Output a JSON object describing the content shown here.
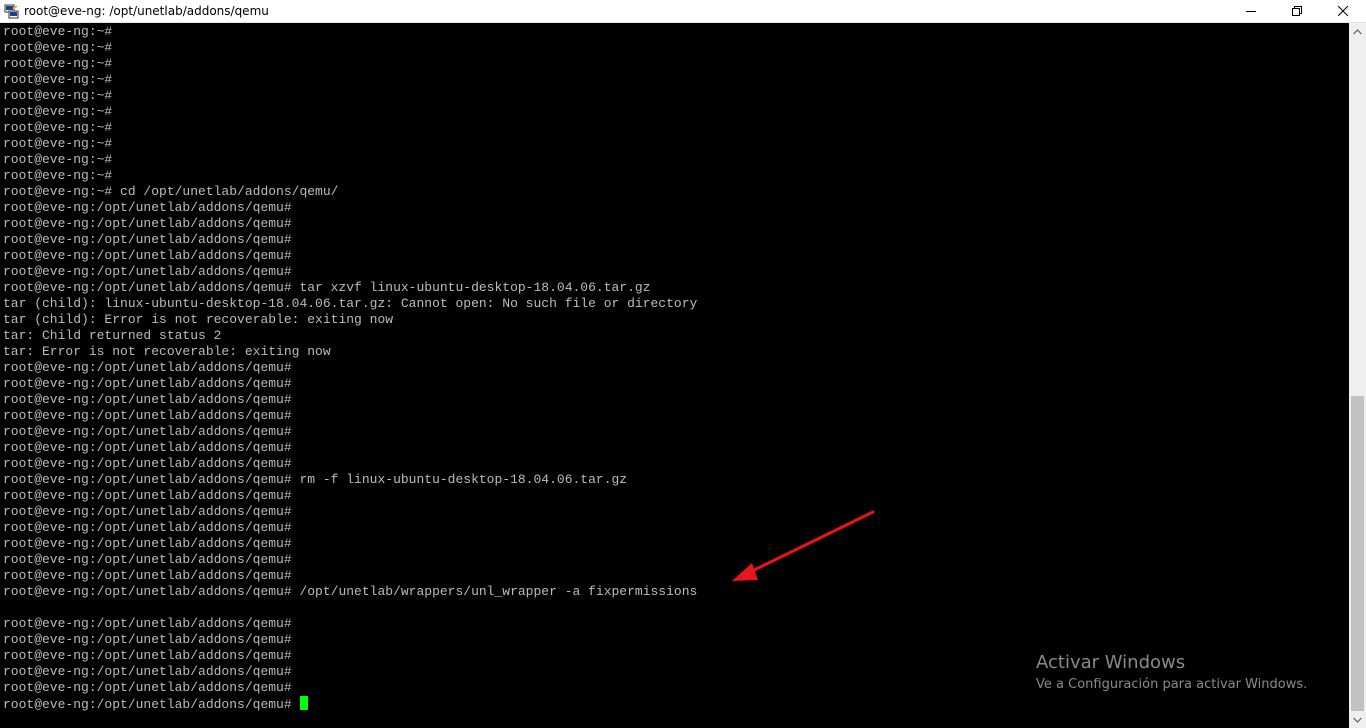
{
  "window": {
    "title": "root@eve-ng: /opt/unetlab/addons/qemu",
    "icon": "putty-icon",
    "controls": [
      "minimize-icon",
      "maximize-icon",
      "close-icon"
    ]
  },
  "terminal": {
    "text_color": "#bbbbbb",
    "cursor_color": "#00ff00",
    "lines": [
      "root@eve-ng:~#",
      "root@eve-ng:~#",
      "root@eve-ng:~#",
      "root@eve-ng:~#",
      "root@eve-ng:~#",
      "root@eve-ng:~#",
      "root@eve-ng:~#",
      "root@eve-ng:~#",
      "root@eve-ng:~#",
      "root@eve-ng:~#",
      "root@eve-ng:~# cd /opt/unetlab/addons/qemu/",
      "root@eve-ng:/opt/unetlab/addons/qemu#",
      "root@eve-ng:/opt/unetlab/addons/qemu#",
      "root@eve-ng:/opt/unetlab/addons/qemu#",
      "root@eve-ng:/opt/unetlab/addons/qemu#",
      "root@eve-ng:/opt/unetlab/addons/qemu#",
      "root@eve-ng:/opt/unetlab/addons/qemu# tar xzvf linux-ubuntu-desktop-18.04.06.tar.gz",
      "tar (child): linux-ubuntu-desktop-18.04.06.tar.gz: Cannot open: No such file or directory",
      "tar (child): Error is not recoverable: exiting now",
      "tar: Child returned status 2",
      "tar: Error is not recoverable: exiting now",
      "root@eve-ng:/opt/unetlab/addons/qemu#",
      "root@eve-ng:/opt/unetlab/addons/qemu#",
      "root@eve-ng:/opt/unetlab/addons/qemu#",
      "root@eve-ng:/opt/unetlab/addons/qemu#",
      "root@eve-ng:/opt/unetlab/addons/qemu#",
      "root@eve-ng:/opt/unetlab/addons/qemu#",
      "root@eve-ng:/opt/unetlab/addons/qemu#",
      "root@eve-ng:/opt/unetlab/addons/qemu# rm -f linux-ubuntu-desktop-18.04.06.tar.gz",
      "root@eve-ng:/opt/unetlab/addons/qemu#",
      "root@eve-ng:/opt/unetlab/addons/qemu#",
      "root@eve-ng:/opt/unetlab/addons/qemu#",
      "root@eve-ng:/opt/unetlab/addons/qemu#",
      "root@eve-ng:/opt/unetlab/addons/qemu#",
      "root@eve-ng:/opt/unetlab/addons/qemu#",
      "root@eve-ng:/opt/unetlab/addons/qemu# /opt/unetlab/wrappers/unl_wrapper -a fixpermissions",
      "",
      "root@eve-ng:/opt/unetlab/addons/qemu#",
      "root@eve-ng:/opt/unetlab/addons/qemu#",
      "root@eve-ng:/opt/unetlab/addons/qemu#",
      "root@eve-ng:/opt/unetlab/addons/qemu#",
      "root@eve-ng:/opt/unetlab/addons/qemu#",
      "root@eve-ng:/opt/unetlab/addons/qemu#"
    ]
  },
  "scrollbar": {
    "position_fraction": 0.51,
    "visible_fraction": 0.47
  },
  "annotation": {
    "arrow_color": "#e8141b",
    "target": "fixpermissions command"
  },
  "watermark": {
    "title": "Activar Windows",
    "subtitle": "Ve a Configuración para activar Windows."
  }
}
